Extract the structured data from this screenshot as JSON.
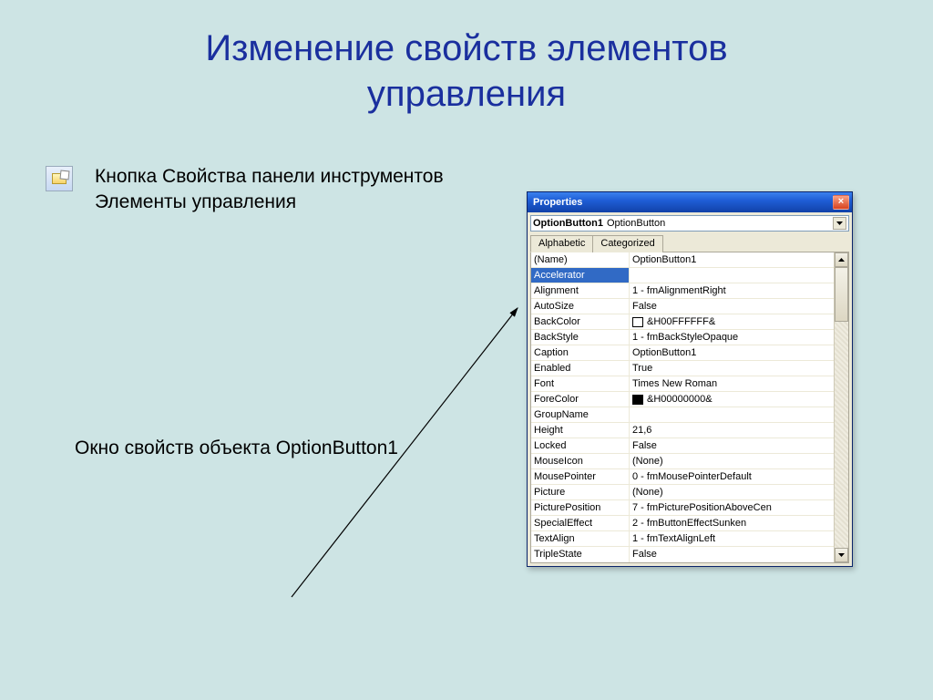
{
  "slide": {
    "title_line1": "Изменение свойств элементов",
    "title_line2": "управления",
    "bullet": "Кнопка Свойства панели инструментов Элементы управления",
    "caption": "Окно свойств объекта OptionButton1"
  },
  "properties_window": {
    "title": "Properties",
    "close": "×",
    "object_name": "OptionButton1",
    "object_type": "OptionButton",
    "tabs": {
      "alphabetic": "Alphabetic",
      "categorized": "Categorized"
    },
    "rows": [
      {
        "name": "(Name)",
        "value": "OptionButton1"
      },
      {
        "name": "Accelerator",
        "value": "",
        "selected": true
      },
      {
        "name": "Alignment",
        "value": "1 - fmAlignmentRight"
      },
      {
        "name": "AutoSize",
        "value": "False"
      },
      {
        "name": "BackColor",
        "value": "&H00FFFFFF&",
        "swatch": "white"
      },
      {
        "name": "BackStyle",
        "value": "1 - fmBackStyleOpaque"
      },
      {
        "name": "Caption",
        "value": "OptionButton1"
      },
      {
        "name": "Enabled",
        "value": "True"
      },
      {
        "name": "Font",
        "value": "Times New Roman"
      },
      {
        "name": "ForeColor",
        "value": "&H00000000&",
        "swatch": "black"
      },
      {
        "name": "GroupName",
        "value": ""
      },
      {
        "name": "Height",
        "value": "21,6"
      },
      {
        "name": "Locked",
        "value": "False"
      },
      {
        "name": "MouseIcon",
        "value": "(None)"
      },
      {
        "name": "MousePointer",
        "value": "0 - fmMousePointerDefault"
      },
      {
        "name": "Picture",
        "value": "(None)"
      },
      {
        "name": "PicturePosition",
        "value": "7 - fmPicturePositionAboveCen"
      },
      {
        "name": "SpecialEffect",
        "value": "2 - fmButtonEffectSunken"
      },
      {
        "name": "TextAlign",
        "value": "1 - fmTextAlignLeft"
      },
      {
        "name": "TripleState",
        "value": "False"
      }
    ]
  }
}
